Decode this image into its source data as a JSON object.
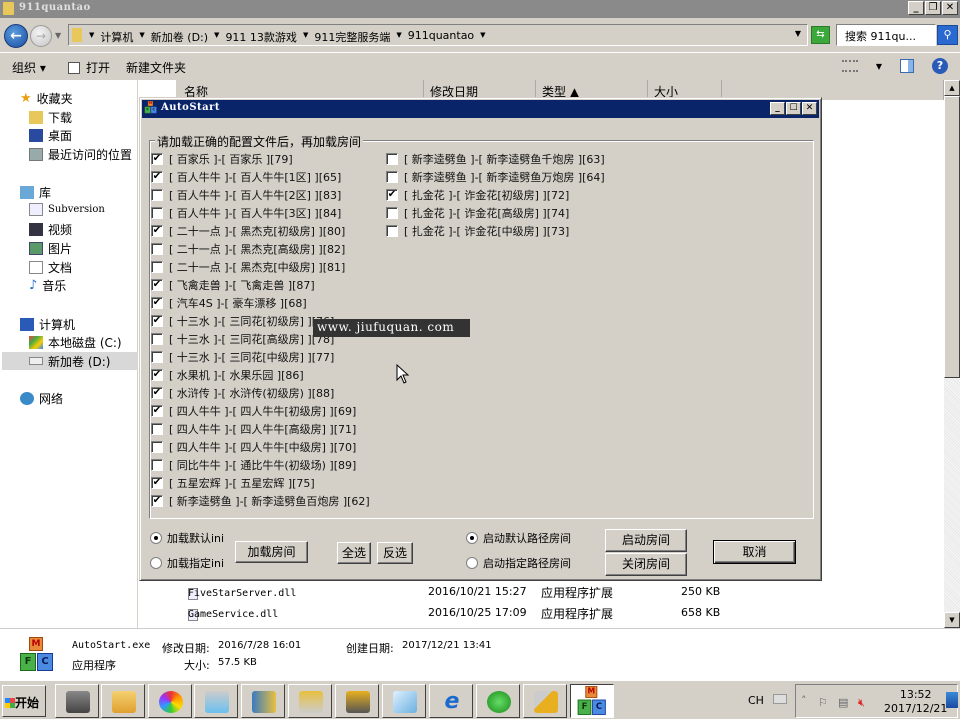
{
  "explorer": {
    "title": "911quantao",
    "breadcrumbs": [
      "计算机",
      "新加卷 (D:)",
      "911 13款游戏",
      "911完整服务端",
      "911quantao"
    ],
    "search_placeholder": "搜索 911qu...",
    "toolbar": {
      "organize": "组织 ▾",
      "open": "打开",
      "new_folder": "新建文件夹"
    },
    "nav": {
      "favorites": "收藏夹",
      "downloads": "下载",
      "desktop": "桌面",
      "recent": "最近访问的位置",
      "libraries": "库",
      "subversion": "Subversion",
      "videos": "视频",
      "pictures": "图片",
      "documents": "文档",
      "music": "音乐",
      "computer": "计算机",
      "local_disk": "本地磁盘 (C:)",
      "new_volume": "新加卷 (D:)",
      "network": "网络"
    },
    "columns": {
      "name": "名称",
      "modified": "修改日期",
      "type": "类型 ▲",
      "size": "大小"
    },
    "files": [
      {
        "name": "FiveStarServer.dll",
        "modified": "2016/10/21 15:27",
        "type": "应用程序扩展",
        "size": "250 KB"
      },
      {
        "name": "GameService.dll",
        "modified": "2016/10/25 17:09",
        "type": "应用程序扩展",
        "size": "658 KB"
      }
    ],
    "details": {
      "filename": "AutoStart.exe",
      "modified_label": "修改日期:",
      "modified_value": "2016/7/28 16:01",
      "created_label": "创建日期:",
      "created_value": "2017/12/21 13:41",
      "type": "应用程序",
      "size_label": "大小:",
      "size_value": "57.5 KB"
    }
  },
  "dialog": {
    "title": "AutoStart",
    "group_label": "请加载正确的配置文件后，再加载房间",
    "left_items": [
      {
        "label": "[ 百家乐 ]-[ 百家乐 ][79]",
        "checked": true
      },
      {
        "label": "[ 百人牛牛 ]-[ 百人牛牛[1区] ][65]",
        "checked": true
      },
      {
        "label": "[ 百人牛牛 ]-[ 百人牛牛[2区] ][83]",
        "checked": false
      },
      {
        "label": "[ 百人牛牛 ]-[ 百人牛牛[3区] ][84]",
        "checked": false
      },
      {
        "label": "[ 二十一点 ]-[ 黑杰克[初级房] ][80]",
        "checked": true
      },
      {
        "label": "[ 二十一点 ]-[ 黑杰克[高级房] ][82]",
        "checked": false
      },
      {
        "label": "[ 二十一点 ]-[ 黑杰克[中级房] ][81]",
        "checked": false
      },
      {
        "label": "[ 飞禽走兽 ]-[ 飞禽走兽 ][87]",
        "checked": true
      },
      {
        "label": "[ 汽车4S ]-[ 豪车漂移 ][68]",
        "checked": true
      },
      {
        "label": "[ 十三水 ]-[ 三同花[初级房] ][76]",
        "checked": true
      },
      {
        "label": "[ 十三水 ]-[ 三同花[高级房] ][78]",
        "checked": false
      },
      {
        "label": "[ 十三水 ]-[ 三同花[中级房] ][77]",
        "checked": false
      },
      {
        "label": "[ 水果机 ]-[ 水果乐园 ][86]",
        "checked": true
      },
      {
        "label": "[ 水浒传 ]-[ 水浒传(初级房) ][88]",
        "checked": true
      },
      {
        "label": "[ 四人牛牛 ]-[ 四人牛牛[初级房] ][69]",
        "checked": true
      },
      {
        "label": "[ 四人牛牛 ]-[ 四人牛牛[高级房] ][71]",
        "checked": false
      },
      {
        "label": "[ 四人牛牛 ]-[ 四人牛牛[中级房] ][70]",
        "checked": false
      },
      {
        "label": "[ 同比牛牛 ]-[ 通比牛牛(初级场) ][89]",
        "checked": false
      },
      {
        "label": "[ 五星宏辉 ]-[ 五星宏辉 ][75]",
        "checked": true
      },
      {
        "label": "[ 新李逵劈鱼 ]-[ 新李逵劈鱼百炮房 ][62]",
        "checked": true
      }
    ],
    "right_items": [
      {
        "label": "[ 新李逵劈鱼 ]-[ 新李逵劈鱼千炮房 ][63]",
        "checked": false
      },
      {
        "label": "[ 新李逵劈鱼 ]-[ 新李逵劈鱼万炮房 ][64]",
        "checked": false
      },
      {
        "label": "[ 扎金花 ]-[ 诈金花[初级房] ][72]",
        "checked": true
      },
      {
        "label": "[ 扎金花 ]-[ 诈金花[高级房] ][74]",
        "checked": false
      },
      {
        "label": "[ 扎金花 ]-[ 诈金花[中级房] ][73]",
        "checked": false
      }
    ],
    "radio_load_default": "加载默认ini",
    "radio_load_custom": "加载指定ini",
    "load_selected": "default",
    "btn_load_rooms": "加载房间",
    "btn_select_all": "全选",
    "btn_invert": "反选",
    "radio_start_default": "启动默认路径房间",
    "radio_start_custom": "启动指定路径房间",
    "start_selected": "default",
    "btn_start_rooms": "启动房间",
    "btn_close_rooms": "关闭房间",
    "btn_cancel": "取消"
  },
  "watermark": "www. jiufuquan. com",
  "taskbar": {
    "start": "开始",
    "lang": "CH",
    "time": "13:52",
    "date": "2017/12/21"
  },
  "check_mark": "✔"
}
